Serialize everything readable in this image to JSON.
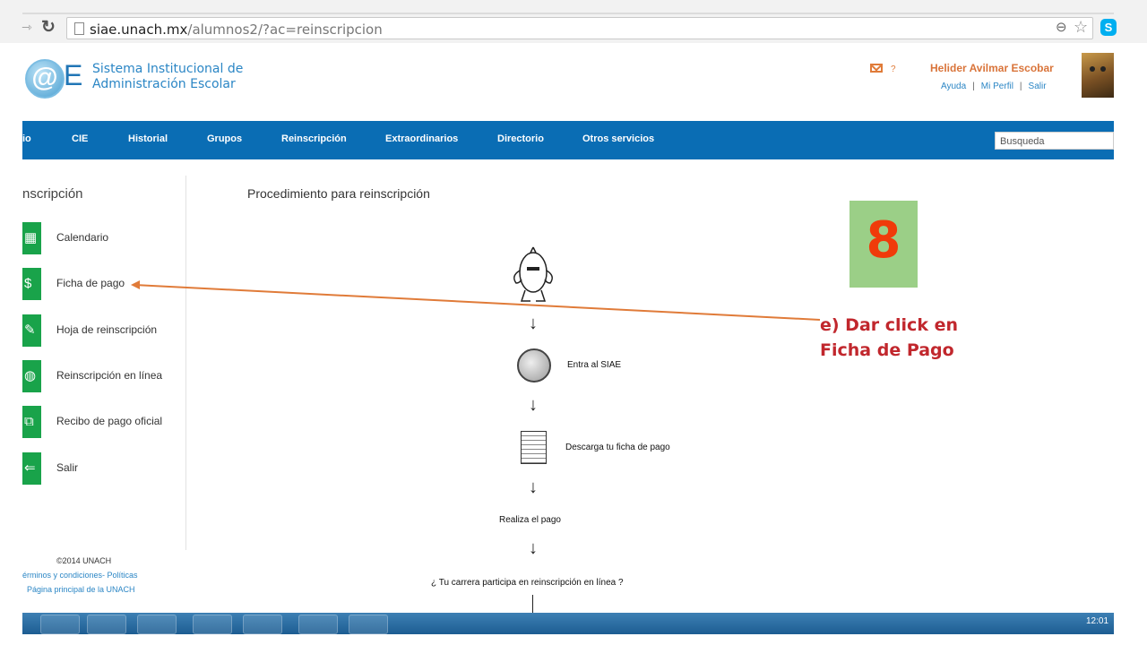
{
  "browser": {
    "url_host": "siae.unach.mx",
    "url_path": "/alumnos2/?ac=reinscripcion",
    "forward_icon": "forward-arrow-icon",
    "reload_icon": "reload-icon",
    "zoom_icon": "zoom-icon",
    "star_icon": "bookmark-star-icon",
    "skype_label": "S"
  },
  "header": {
    "logo_mark": "@",
    "logo_letter": "E",
    "title_line1": "Sistema Institucional de",
    "title_line2": "Administración Escolar",
    "help": "?",
    "user_name": "Helider Avilmar Escobar",
    "links": [
      "Ayuda",
      "Mi Perfil",
      "Salir"
    ],
    "separator": "|"
  },
  "nav": {
    "items": [
      "io",
      "CIE",
      "Historial",
      "Grupos",
      "Reinscripción",
      "Extraordinarios",
      "Directorio",
      "Otros servicios"
    ],
    "search_placeholder": "Busqueda"
  },
  "sidebar": {
    "title": "nscripción",
    "items": [
      {
        "label": "Calendario",
        "icon": "calendar-icon",
        "glyph": "▦"
      },
      {
        "label": "Ficha de pago",
        "icon": "dollar-icon",
        "glyph": "$"
      },
      {
        "label": "Hoja de reinscripción",
        "icon": "pencil-icon",
        "glyph": "✎"
      },
      {
        "label": "Reinscripción en línea",
        "icon": "globe-icon",
        "glyph": "◍"
      },
      {
        "label": "Recibo de pago oficial",
        "icon": "receipt-icon",
        "glyph": "⧉"
      },
      {
        "label": "Salir",
        "icon": "exit-arrow-icon",
        "glyph": "⇐"
      }
    ],
    "footer": {
      "copyright": "©2014 UNACH",
      "terms": "érminos y condiciones- Políticas",
      "home": "Página principal de la UNACH"
    }
  },
  "main": {
    "title": "Procedimiento para reinscripción",
    "steps": [
      "Entra al SIAE",
      "Descarga tu ficha de pago",
      "Realiza el pago",
      "¿ Tu carrera participa en reinscripción en línea ?"
    ],
    "arrow_glyph": "↓"
  },
  "annotation": {
    "number": "8",
    "line1": "e) Dar click en",
    "line2": "Ficha de Pago",
    "color": "#c1272d",
    "arrow_color": "#e07b39"
  },
  "taskbar": {
    "clock": "12:01"
  },
  "colors": {
    "nav_bg": "#0a6db4",
    "sidebar_icon_bg": "#19a34a",
    "user_name": "#d9743a"
  }
}
